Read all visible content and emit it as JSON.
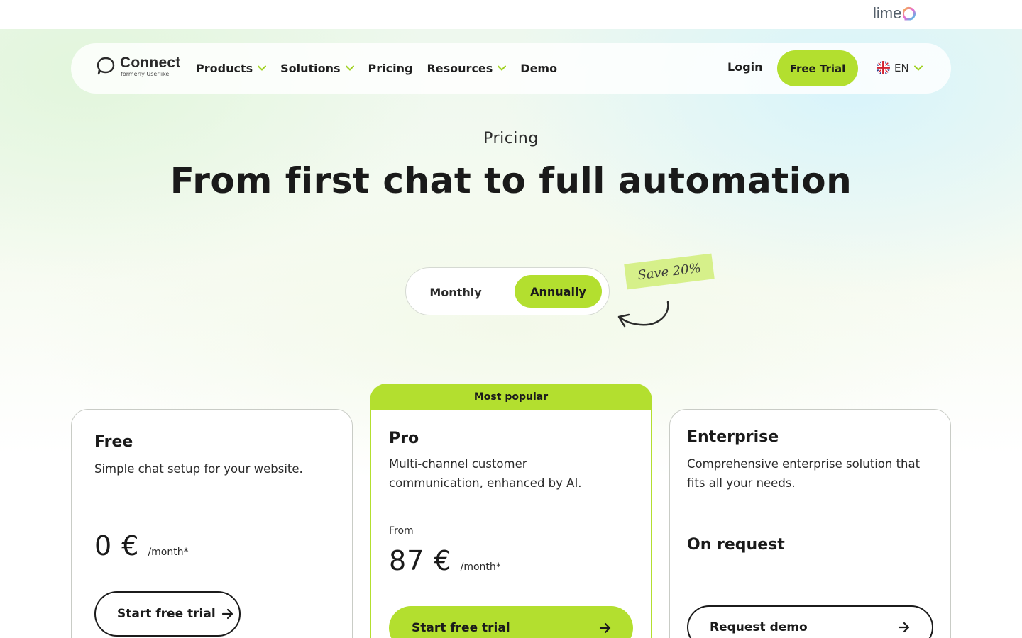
{
  "colors": {
    "accent": "#b3df2f",
    "text": "#1b1b1b",
    "border": "#c9ccc6",
    "save_tag": "#d6f08a"
  },
  "topbar": {
    "logo_text": "lime",
    "logo_icon": "lime-ring-icon"
  },
  "nav": {
    "brand_name": "Connect",
    "brand_sub": "formerly Userlike",
    "items": [
      {
        "label": "Products",
        "has_dropdown": true
      },
      {
        "label": "Solutions",
        "has_dropdown": true
      },
      {
        "label": "Pricing",
        "has_dropdown": false
      },
      {
        "label": "Resources",
        "has_dropdown": true
      },
      {
        "label": "Demo",
        "has_dropdown": false
      }
    ],
    "login": "Login",
    "free_trial": "Free Trial",
    "language": "EN",
    "language_icon": "uk-flag-icon"
  },
  "hero": {
    "eyebrow": "Pricing",
    "headline": "From first chat to full automation"
  },
  "billing_toggle": {
    "options": [
      "Monthly",
      "Annually"
    ],
    "selected": "Annually",
    "save_note": "Save 20%"
  },
  "plans": {
    "free": {
      "name": "Free",
      "description": "Simple chat setup for your website.",
      "price": "0 €",
      "unit": "/month*",
      "cta": "Start free trial"
    },
    "pro": {
      "badge": "Most popular",
      "name": "Pro",
      "description_line1": "Multi-channel customer",
      "description_line2": "communication, enhanced by AI.",
      "from": "From",
      "price": "87 €",
      "unit": "/month*",
      "cta": "Start free trial"
    },
    "enterprise": {
      "name": "Enterprise",
      "description_line1": "Comprehensive enterprise solution that",
      "description_line2": "fits all your needs.",
      "price_text": "On request",
      "cta": "Request demo"
    }
  }
}
